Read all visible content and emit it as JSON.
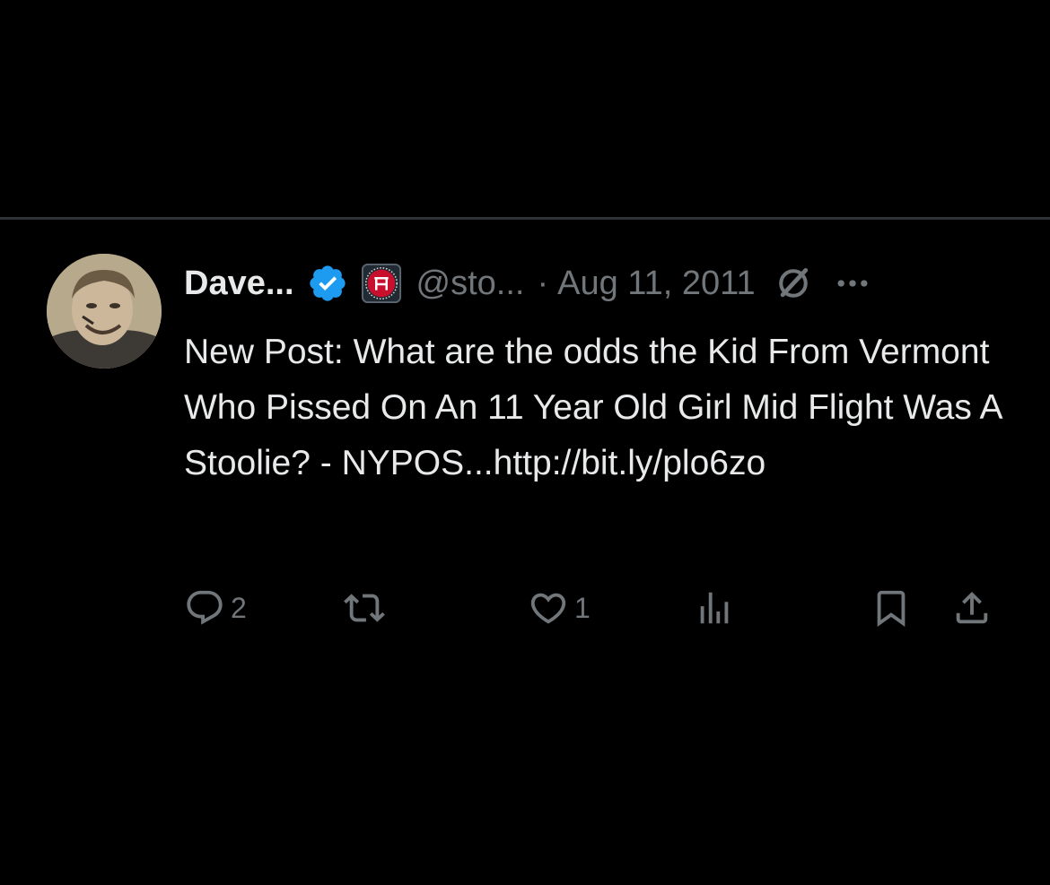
{
  "tweet": {
    "display_name": "Dave...",
    "handle": "@sto...",
    "separator": "·",
    "date": "Aug 11, 2011",
    "text": "New Post:  What are the odds the Kid From Vermont Who Pissed On An 11 Year Old Girl Mid Flight Was A Stoolie? - NYPOS...http://bit.ly/plo6zo"
  },
  "actions": {
    "reply_count": "2",
    "retweet_count": "",
    "like_count": "1",
    "views_count": ""
  },
  "colors": {
    "background": "#000000",
    "primary_text": "#e7e9ea",
    "secondary_text": "#71767b",
    "verified_badge": "#1d9bf0",
    "divider": "#2f3336",
    "affiliate_badge": "#c8102e"
  },
  "icons": [
    "verified-badge-icon",
    "affiliate-logo-icon",
    "edit-history-icon",
    "more-icon",
    "reply-icon",
    "retweet-icon",
    "like-icon",
    "views-icon",
    "bookmark-icon",
    "share-icon"
  ]
}
